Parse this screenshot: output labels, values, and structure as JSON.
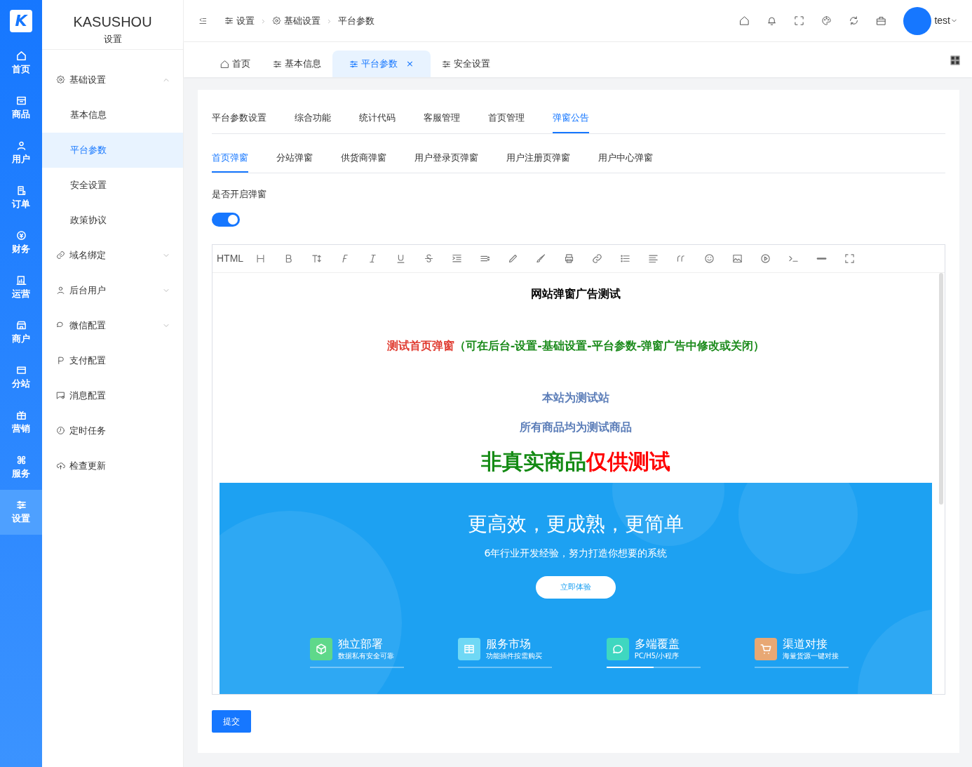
{
  "rail": {
    "logo": "K",
    "items": [
      {
        "label": "首页",
        "selected": false
      },
      {
        "label": "商品",
        "selected": false
      },
      {
        "label": "用户",
        "selected": false
      },
      {
        "label": "订单",
        "selected": false
      },
      {
        "label": "财务",
        "selected": false
      },
      {
        "label": "运营",
        "selected": false
      },
      {
        "label": "商户",
        "selected": false
      },
      {
        "label": "分站",
        "selected": false
      },
      {
        "label": "营销",
        "selected": false
      },
      {
        "label": "服务",
        "selected": false
      },
      {
        "label": "设置",
        "selected": true
      }
    ]
  },
  "sidebar": {
    "brand": "KASUSHOU",
    "section": "设置",
    "items": [
      {
        "label": "基础设置",
        "kind": "group",
        "expanded": true,
        "children": [
          {
            "label": "基本信息",
            "selected": false
          },
          {
            "label": "平台参数",
            "selected": true
          },
          {
            "label": "安全设置",
            "selected": false
          },
          {
            "label": "政策协议",
            "selected": false
          }
        ]
      },
      {
        "label": "域名绑定",
        "kind": "group",
        "expanded": false
      },
      {
        "label": "后台用户",
        "kind": "group",
        "expanded": false
      },
      {
        "label": "微信配置",
        "kind": "group",
        "expanded": false
      },
      {
        "label": "支付配置",
        "kind": "link"
      },
      {
        "label": "消息配置",
        "kind": "link"
      },
      {
        "label": "定时任务",
        "kind": "link"
      },
      {
        "label": "检查更新",
        "kind": "link"
      }
    ]
  },
  "header": {
    "breadcrumb": [
      "设置",
      "基础设置",
      "平台参数"
    ],
    "user": "test"
  },
  "page_tabs": [
    {
      "label": "首页",
      "selected": false
    },
    {
      "label": "基本信息",
      "selected": false
    },
    {
      "label": "平台参数",
      "selected": true,
      "close": "×"
    },
    {
      "label": "安全设置",
      "selected": false
    }
  ],
  "settings_tabs": [
    {
      "label": "平台参数设置",
      "selected": false
    },
    {
      "label": "综合功能",
      "selected": false
    },
    {
      "label": "统计代码",
      "selected": false
    },
    {
      "label": "客服管理",
      "selected": false
    },
    {
      "label": "首页管理",
      "selected": false
    },
    {
      "label": "弹窗公告",
      "selected": true
    }
  ],
  "popup_tabs": [
    {
      "label": "首页弹窗",
      "selected": true
    },
    {
      "label": "分站弹窗",
      "selected": false
    },
    {
      "label": "供货商弹窗",
      "selected": false
    },
    {
      "label": "用户登录页弹窗",
      "selected": false
    },
    {
      "label": "用户注册页弹窗",
      "selected": false
    },
    {
      "label": "用户中心弹窗",
      "selected": false
    }
  ],
  "popup_switch": {
    "label": "是否开启弹窗",
    "on": true
  },
  "editor": {
    "toolbar_label": "HTML",
    "content": [
      {
        "kind": "text",
        "segments": [
          {
            "text": "网站弹窗广告测试",
            "color": "#000000"
          }
        ]
      },
      {
        "kind": "text",
        "segments": [
          {
            "text": "测试首页弹窗",
            "color": "#e03c31"
          },
          {
            "text": "（可在后台-设置-基础设置-平台参数-弹窗广告中修改或关闭）",
            "color": "#1a8a1a"
          }
        ]
      },
      {
        "kind": "text",
        "segments": [
          {
            "text": "本站为测试站",
            "color": "#5b7db8"
          }
        ]
      },
      {
        "kind": "text",
        "segments": [
          {
            "text": "所有商品均为测试商品",
            "color": "#5b7db8"
          }
        ]
      },
      {
        "kind": "headline",
        "segments": [
          {
            "text": "非真实商品",
            "color": "#138a13"
          },
          {
            "text": "仅供测试",
            "color": "#ff0000"
          }
        ]
      },
      {
        "kind": "banner",
        "title": "更高效，更成熟，更简单",
        "subtitle": "6年行业开发经验，努力打造你想要的系统",
        "button": "立即体验",
        "features": [
          {
            "title": "独立部署",
            "text": "数据私有安全可靠",
            "color": "#5fd88a",
            "selected": false
          },
          {
            "title": "服务市场",
            "text": "功能插件按需购买",
            "color": "#6fd8f5",
            "selected": false
          },
          {
            "title": "多端覆盖",
            "text": "PC/H5/小程序",
            "color": "#3fd7c0",
            "selected": true
          },
          {
            "title": "渠道对接",
            "text": "海量货源一键对接",
            "color": "#e8a874",
            "selected": false
          }
        ]
      }
    ]
  },
  "submit": "提交"
}
